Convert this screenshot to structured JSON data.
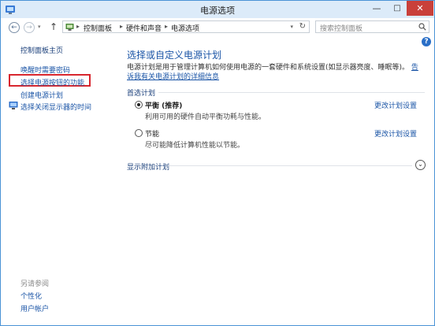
{
  "window": {
    "title": "电源选项",
    "minimize": "—",
    "maximize": "□",
    "close": "✕"
  },
  "nav": {
    "back": "←",
    "forward": "→",
    "history_dropdown": "▾",
    "up": "↑",
    "breadcrumb": [
      "控制面板",
      "硬件和声音",
      "电源选项"
    ],
    "separator": "▸",
    "address_dropdown": "▾",
    "refresh": "↻",
    "search_placeholder": "搜索控制面板"
  },
  "sidebar": {
    "home": "控制面板主页",
    "links": [
      "唤醒时需要密码",
      "选择电源按钮的功能",
      "创建电源计划",
      "选择关闭显示器的时间"
    ],
    "see_also_label": "另请参阅",
    "see_also": [
      "个性化",
      "用户帐户"
    ]
  },
  "main": {
    "help": "?",
    "title": "选择或自定义电源计划",
    "description": "电源计划是用于管理计算机如何使用电源的一套硬件和系统设置(如显示器亮度、睡眠等)。",
    "description_link": "告诉我有关电源计划的详细信息",
    "preferred_label": "首选计划",
    "plans": [
      {
        "name": "平衡 (推荐)",
        "desc": "利用可用的硬件自动平衡功耗与性能。",
        "link": "更改计划设置",
        "selected": true
      },
      {
        "name": "节能",
        "desc": "尽可能降低计算机性能以节能。",
        "link": "更改计划设置",
        "selected": false
      }
    ],
    "show_more": "显示附加计划",
    "expand": "⌄"
  },
  "colors": {
    "accent": "#1a54a6",
    "titlebar": "#dcebf9",
    "close": "#c9403a",
    "highlight_box": "#d8262e"
  }
}
